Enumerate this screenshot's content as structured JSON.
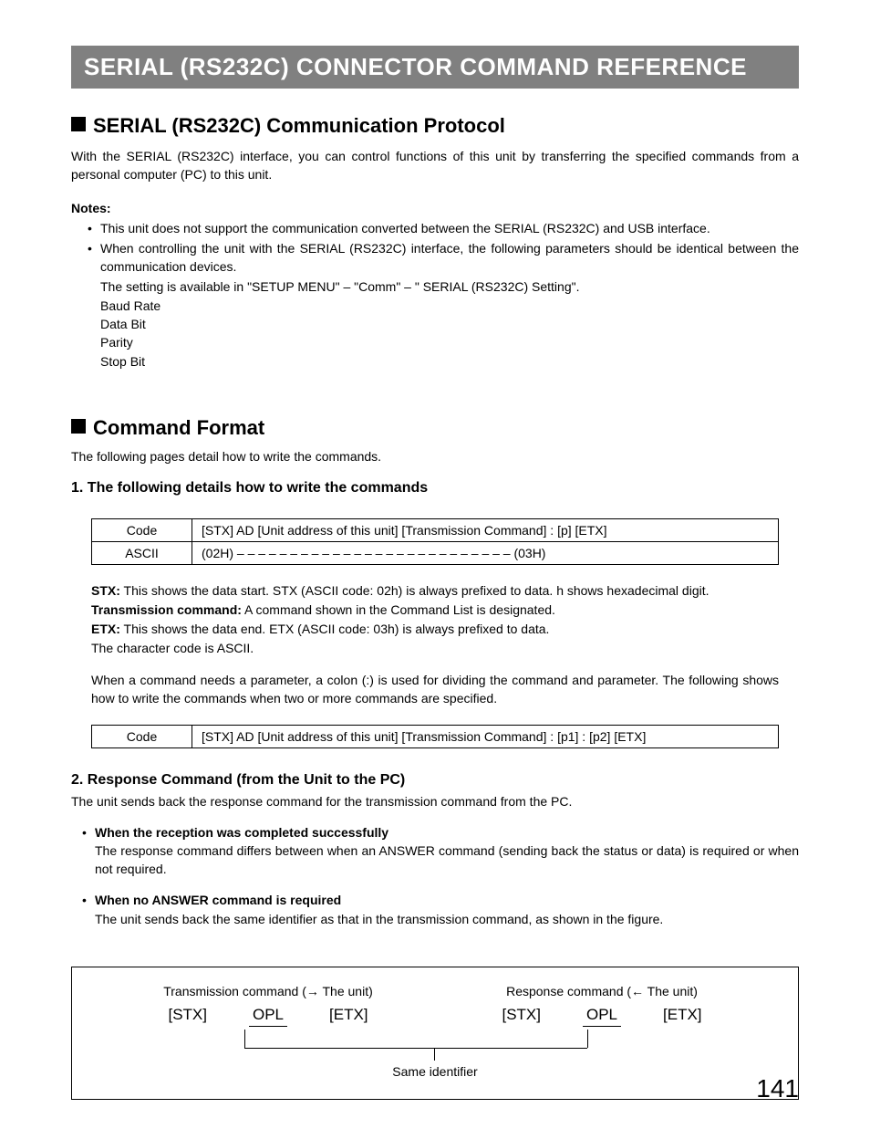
{
  "banner": "SERIAL (RS232C) CONNECTOR COMMAND REFERENCE",
  "section1": {
    "title": "SERIAL (RS232C) Communication Protocol",
    "intro": "With the SERIAL (RS232C) interface, you can control functions of this unit by transferring the specified commands from a personal computer (PC) to this unit.",
    "notes_label": "Notes:",
    "bullet1": "This unit does not support the communication converted between the SERIAL (RS232C) and USB interface.",
    "bullet2": "When controlling the unit with the SERIAL (RS232C) interface, the following parameters should be identical between the communication devices.",
    "sub1": "The setting is available in \"SETUP MENU\" – \"Comm\" – \" SERIAL (RS232C) Setting\".",
    "sub2": "Baud Rate",
    "sub3": "Data Bit",
    "sub4": "Parity",
    "sub5": "Stop Bit"
  },
  "section2": {
    "title": "Command Format",
    "intro": "The following pages detail how to write the commands.",
    "h3_1": "1. The following details how to write the commands",
    "table1": {
      "r1c1": "Code",
      "r1c2": "[STX] AD [Unit address of this unit] [Transmission Command] : [p] [ETX]",
      "r2c1": "ASCII",
      "r2c2": "(02H)   – – – – – – – – – – – – – – – – – – – – – – – – – –   (03H)"
    },
    "defs": {
      "stx_l": "STX:",
      "stx_t": " This shows the data start. STX (ASCII code: 02h) is always prefixed to data. h shows hexadecimal digit.",
      "tc_l": "Transmission command:",
      "tc_t": " A command shown in the Command List is designated.",
      "etx_l": "ETX:",
      "etx_t": " This shows the data end. ETX (ASCII code: 03h) is always prefixed to data.",
      "cc": "The character code is ASCII."
    },
    "para": "When a command needs a parameter, a colon (:) is used for dividing the command and parameter. The following shows how to write the commands when two or more commands are specified.",
    "table2": {
      "r1c1": "Code",
      "r1c2": "[STX] AD [Unit address of this unit] [Transmission Command] : [p1] : [p2] [ETX]"
    },
    "h3_2": "2. Response Command (from the Unit to the PC)",
    "resp_intro": "The unit sends back the response command for the transmission command from the PC.",
    "sb1_h": "When the reception was completed successfully",
    "sb1_t": "The response command differs between when an ANSWER command (sending back the status or data) is required or when not required.",
    "sb2_h": "When no ANSWER command is required",
    "sb2_t": "The unit sends back the same identifier as that in the transmission command, as shown in the figure."
  },
  "diagram": {
    "left_label": "Transmission command (→ The unit)",
    "right_label": "Response command (← The unit)",
    "tok1": "[STX]",
    "tok2": "OPL",
    "tok3": "[ETX]",
    "tok4": "[STX]",
    "tok5": "OPL",
    "tok6": "[ETX]",
    "same": "Same identifier"
  },
  "page_number": "141"
}
